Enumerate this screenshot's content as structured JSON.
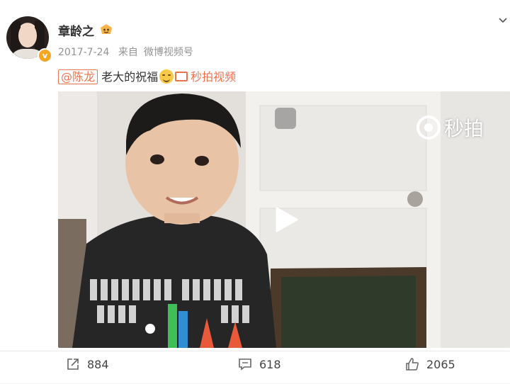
{
  "post": {
    "username": "章龄之",
    "date": "2017-7-24",
    "source_prefix": "来自",
    "source": "微博视频号",
    "mention": "@陈龙",
    "text": "老大的祝福",
    "video_link": "秒拍视频"
  },
  "video": {
    "watermark": "秒拍"
  },
  "actions": {
    "share_count": "884",
    "comment_count": "618",
    "like_count": "2065"
  },
  "icons": {
    "verified": "verified-badge-icon",
    "badge": "member-badge-icon",
    "chevron": "chevron-down-icon",
    "share": "share-icon",
    "comment": "comment-icon",
    "like": "thumbs-up-icon",
    "play": "play-icon",
    "camera": "video-camera-icon"
  },
  "colors": {
    "accent": "#eb7350",
    "verified": "#f5a623",
    "meta_text": "#939393"
  }
}
